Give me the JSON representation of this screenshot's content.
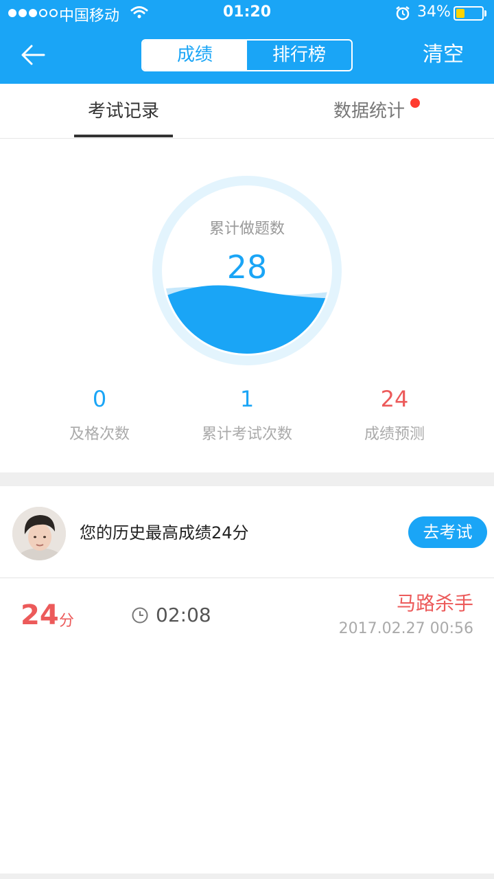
{
  "status_bar": {
    "carrier": "中国移动",
    "time": "01:20",
    "battery_percent": "34%",
    "battery_level": 0.34
  },
  "nav": {
    "segment_active": "成绩",
    "segment_inactive": "排行榜",
    "clear_label": "清空"
  },
  "tabs": {
    "records": "考试记录",
    "statistics": "数据统计"
  },
  "summary": {
    "label": "累计做题数",
    "value": "28"
  },
  "stats": [
    {
      "value": "0",
      "label": "及格次数"
    },
    {
      "value": "1",
      "label": "累计考试次数"
    },
    {
      "value": "24",
      "label": "成绩预测"
    }
  ],
  "best": {
    "text": "您的历史最高成绩24分",
    "button": "去考试"
  },
  "record": {
    "score": "24",
    "unit": "分",
    "duration": "02:08",
    "nickname": "马路杀手",
    "datetime": "2017.02.27 00:56"
  },
  "colors": {
    "primary": "#1aa5f6",
    "accent_red": "#ec5a5a"
  }
}
